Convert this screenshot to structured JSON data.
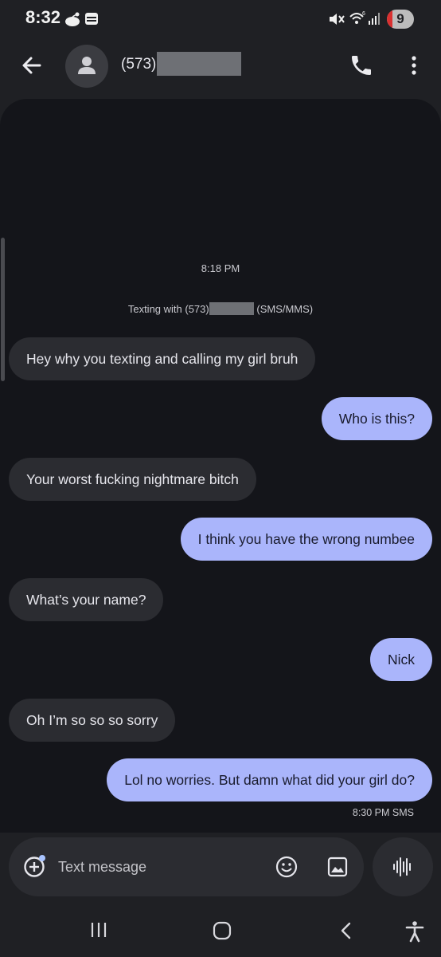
{
  "status_bar": {
    "time": "8:32",
    "battery_level": "9",
    "icons": [
      "app-notification-icon",
      "wallet-icon",
      "mute-icon",
      "wifi-6-icon",
      "signal-icon",
      "battery-icon"
    ]
  },
  "top_bar": {
    "contact": "(573)",
    "icons": [
      "back-arrow-icon",
      "person-icon",
      "phone-icon",
      "more-vert-icon"
    ]
  },
  "conversation": {
    "timestamp": "8:18 PM",
    "texting_with_prefix": "Texting with (573)",
    "texting_with_suffix": "(SMS/MMS)",
    "messages": [
      {
        "direction": "incoming",
        "text": "Hey why you texting and calling my girl bruh"
      },
      {
        "direction": "outgoing",
        "text": "Who is this?"
      },
      {
        "direction": "incoming",
        "text": "Your worst fucking nightmare bitch"
      },
      {
        "direction": "outgoing",
        "text": "I think you have the wrong numbee"
      },
      {
        "direction": "incoming",
        "text": "What’s your name?"
      },
      {
        "direction": "outgoing",
        "text": "Nick"
      },
      {
        "direction": "incoming",
        "text": "Oh I’m so so so sorry"
      },
      {
        "direction": "outgoing",
        "text": "Lol no worries. But damn what did your girl do?"
      }
    ],
    "last_meta": "8:30 PM  SMS"
  },
  "composer": {
    "placeholder": "Text message",
    "icons": [
      "add-icon",
      "emoji-icon",
      "gallery-icon",
      "voice-icon"
    ]
  },
  "nav_bar": {
    "icons": [
      "recents-icon",
      "home-icon",
      "back-icon",
      "accessibility-icon"
    ]
  },
  "colors": {
    "background": "#1f2024",
    "panel": "#14151a",
    "incoming_bubble": "#2b2c31",
    "outgoing_bubble": "#aab5fb",
    "battery_alert": "#d93030"
  }
}
